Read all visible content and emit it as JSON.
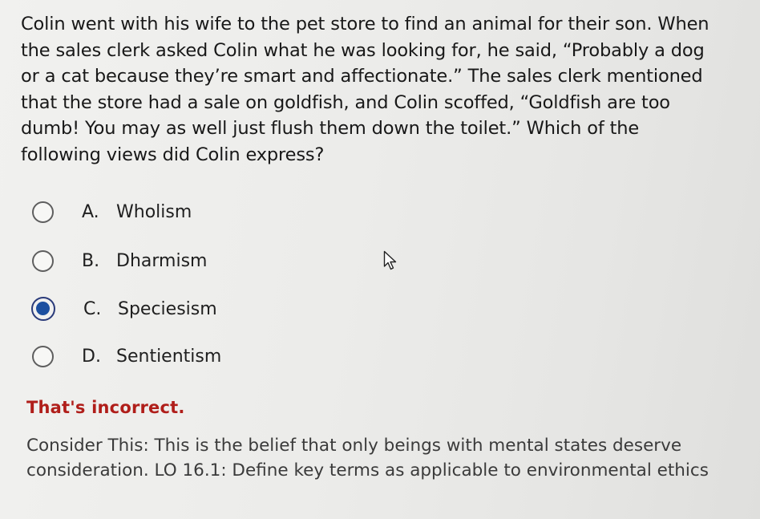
{
  "question": {
    "text": "Colin went with his wife to the pet store to find an animal for their son. When the sales clerk asked Colin what he was looking for, he said, “Probably a dog or a cat because they’re smart and affectionate.” The sales clerk mentioned that the store had a sale on goldfish, and Colin scoffed, “Goldfish are too dumb! You may as well just flush them down the toilet.” Which of the following views did Colin express?"
  },
  "options": [
    {
      "letter": "A.",
      "label": "Wholism",
      "selected": false
    },
    {
      "letter": "B.",
      "label": "Dharmism",
      "selected": false
    },
    {
      "letter": "C.",
      "label": "Speciesism",
      "selected": true
    },
    {
      "letter": "D.",
      "label": "Sentientism",
      "selected": false
    }
  ],
  "feedback": {
    "status": "That's incorrect.",
    "body": "Consider This: This is the belief that only beings with mental states deserve consideration. LO 16.1: Define key terms as applicable to environmental ethics"
  },
  "colors": {
    "feedback_status": "#b01e1a",
    "selected_radio": "#1c4fa0"
  },
  "icons": {
    "cursor": "mouse-pointer-icon"
  }
}
